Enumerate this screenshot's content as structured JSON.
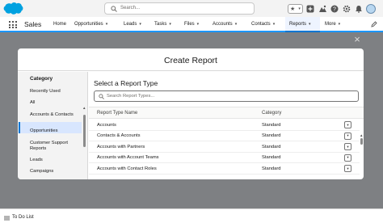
{
  "header": {
    "logo": "salesforce-cloud-logo",
    "search_placeholder": "Search...",
    "star_glyph": "★",
    "star_chevron": "▾",
    "icons": [
      "favorites-star-icon",
      "add-icon",
      "trailhead-icon",
      "help-icon",
      "settings-icon",
      "notifications-bell-icon",
      "user-avatar"
    ],
    "brand_color": "#00a1e0"
  },
  "nav": {
    "app_name": "Sales",
    "items": [
      {
        "label": "Home",
        "has_menu": false
      },
      {
        "label": "Opportunities",
        "has_menu": true
      },
      {
        "label": "Leads",
        "has_menu": true
      },
      {
        "label": "Tasks",
        "has_menu": true
      },
      {
        "label": "Files",
        "has_menu": true
      },
      {
        "label": "Accounts",
        "has_menu": true
      },
      {
        "label": "Contacts",
        "has_menu": true
      },
      {
        "label": "Reports",
        "has_menu": true
      },
      {
        "label": "More",
        "has_menu": true
      }
    ],
    "active_item": "Reports",
    "chevron": "▾",
    "accent_color": "#0176d3"
  },
  "modal": {
    "close_glyph": "×",
    "title": "Create Report",
    "sidebar": {
      "title": "Category",
      "items": [
        "Recently Used",
        "All",
        "Accounts & Contacts",
        "Opportunities",
        "Customer Support Reports",
        "Leads",
        "Campaigns"
      ],
      "selected": "All",
      "scroll_up": "▲",
      "scroll_down": "▼"
    },
    "main": {
      "title": "Select a Report Type",
      "search_placeholder": "Search Report Types...",
      "columns": [
        "Report Type Name",
        "Category"
      ],
      "rows": [
        {
          "name": "Accounts",
          "category": "Standard"
        },
        {
          "name": "Contacts & Accounts",
          "category": "Standard"
        },
        {
          "name": "Accounts with Partners",
          "category": "Standard"
        },
        {
          "name": "Accounts with Account Teams",
          "category": "Standard"
        },
        {
          "name": "Accounts with Contact Roles",
          "category": "Standard"
        }
      ],
      "row_menu_glyph": "▾",
      "scroll_up": "▲"
    }
  },
  "footer": {
    "todo_label": "To Do List"
  }
}
